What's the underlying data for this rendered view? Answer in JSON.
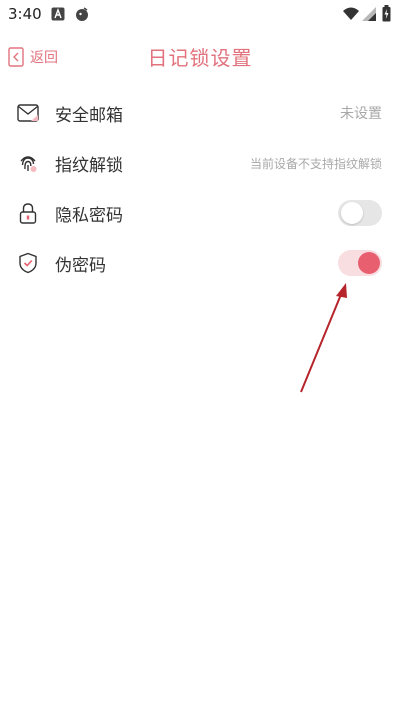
{
  "status_bar": {
    "time": "3:40"
  },
  "header": {
    "back_label": "返回",
    "title": "日记锁设置"
  },
  "settings": [
    {
      "label": "安全邮箱",
      "value": "未设置",
      "icon": "mail-icon"
    },
    {
      "label": "指纹解锁",
      "value": "当前设备不支持指纹解锁",
      "icon": "fingerprint-icon"
    },
    {
      "label": "隐私密码",
      "toggle": "off",
      "icon": "lock-icon"
    },
    {
      "label": "伪密码",
      "toggle": "on",
      "icon": "shield-check-icon"
    }
  ],
  "colors": {
    "accent": "#e2737e",
    "toggle_on_knob": "#e8606f",
    "toggle_on_track": "#f8dde1",
    "toggle_off_track": "#e6e6e6",
    "annotation_arrow": "#b5252b"
  }
}
